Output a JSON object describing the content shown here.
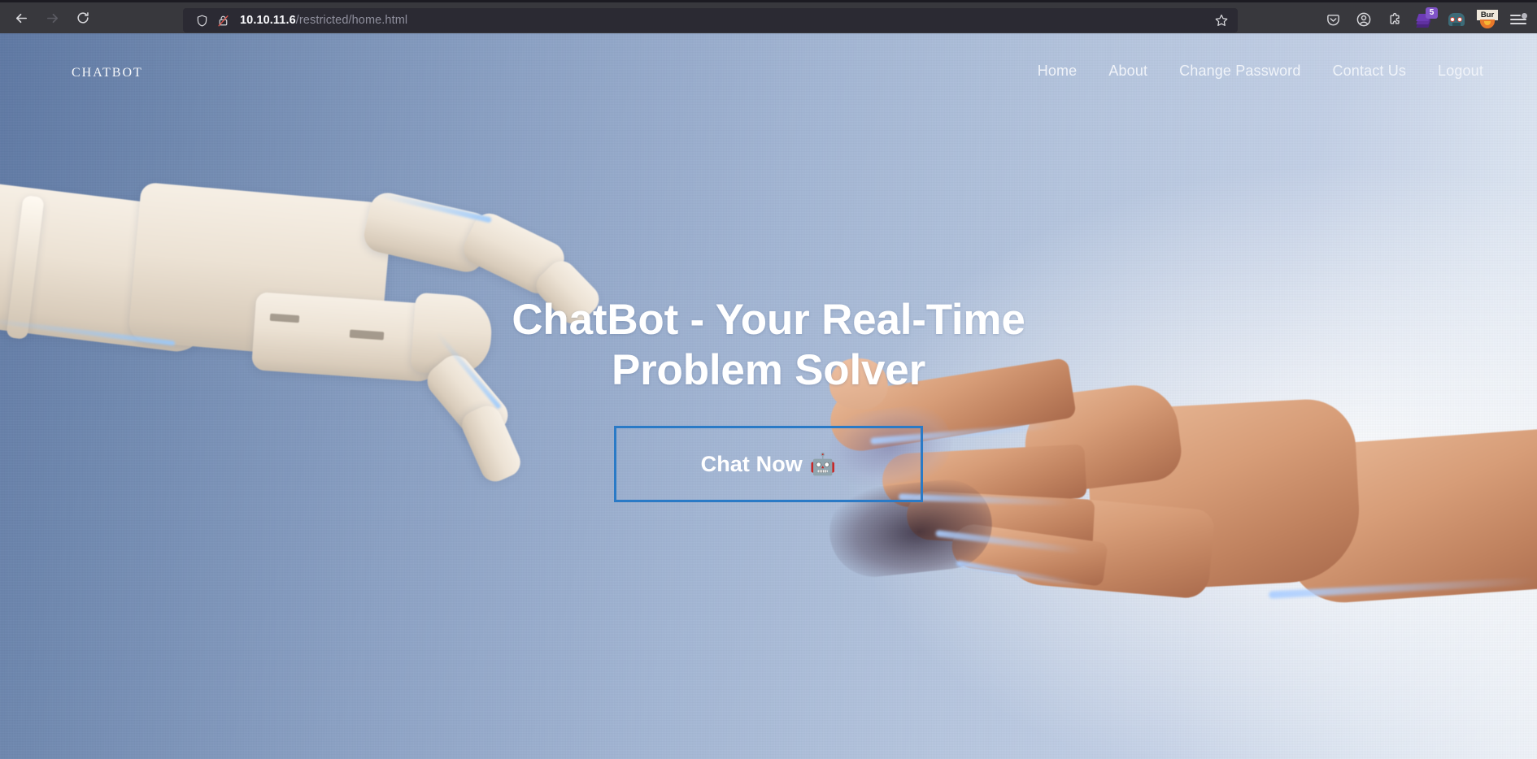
{
  "browser": {
    "back_label": "Back",
    "forward_label": "Forward",
    "reload_label": "Reload",
    "url_host": "10.10.11.6",
    "url_path": "/restricted/home.html",
    "url_full": "10.10.11.6/restricted/home.html",
    "shield_label": "Tracking Protection",
    "lock_label": "Connection is not secure",
    "bookmark_label": "Bookmark this page",
    "toolbar_icons": [
      {
        "name": "pocket-icon",
        "label": "Save to Pocket"
      },
      {
        "name": "account-icon",
        "label": "Account"
      },
      {
        "name": "extensions-icon",
        "label": "Extensions"
      },
      {
        "name": "layers-extension-icon",
        "label": "Extension",
        "badge": "5"
      },
      {
        "name": "wappalyzer-icon",
        "label": "Wappalyzer"
      },
      {
        "name": "burp-suite-icon",
        "label": "Bur"
      },
      {
        "name": "app-menu-icon",
        "label": "Open application menu"
      }
    ]
  },
  "site": {
    "brand": "ChatBot",
    "nav": [
      {
        "label": "Home",
        "name": "nav-home"
      },
      {
        "label": "About",
        "name": "nav-about"
      },
      {
        "label": "Change Password",
        "name": "nav-change-password"
      },
      {
        "label": "Contact Us",
        "name": "nav-contact-us"
      },
      {
        "label": "Logout",
        "name": "nav-logout"
      }
    ],
    "hero": {
      "title": "ChatBot - Your Real-Time Problem Solver",
      "cta_label": "Chat Now",
      "cta_emoji": "🤖",
      "cta_border_color": "#2a7ac6"
    }
  },
  "colors": {
    "chrome_bg": "#38383d",
    "urlbar_bg": "#2b2a33",
    "url_host_text": "#fbfbfe",
    "url_path_text": "#8f8f9d",
    "hero_text": "#ffffff",
    "accent_blue": "#2a7ac6",
    "badge_purple": "#8054c8"
  }
}
